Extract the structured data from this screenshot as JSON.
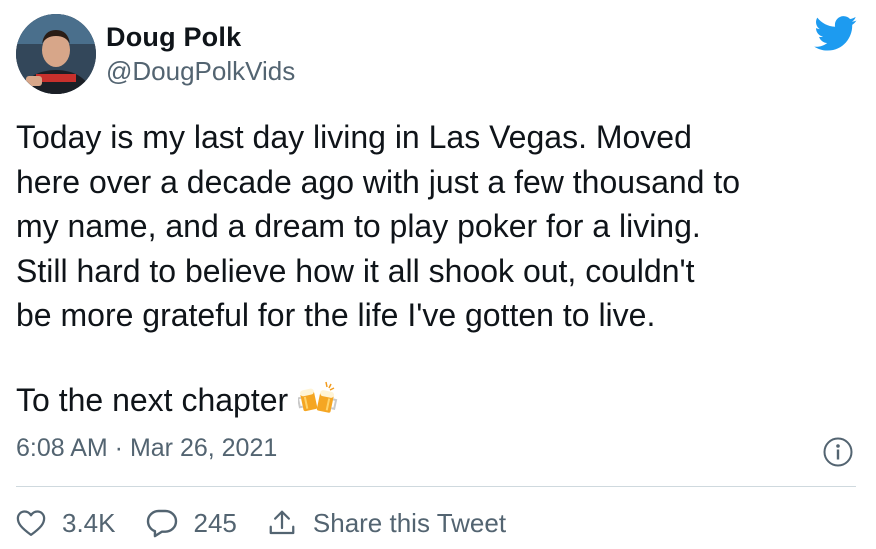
{
  "author": {
    "name": "Doug Polk",
    "handle": "@DougPolkVids"
  },
  "tweet": {
    "text": "Today is my last day living in Las Vegas. Moved\nhere over a decade ago with just a few thousand to\nmy name, and a dream to play poker for a living.\nStill hard to believe how it all shook out, couldn't\nbe more grateful for the life I've gotten to live.",
    "closing_text": "To the next chapter",
    "emoji": "clinking-beer-mugs",
    "timestamp": "6:08 AM · Mar 26, 2021"
  },
  "actions": {
    "like_count": "3.4K",
    "reply_count": "245",
    "share_label": "Share this Tweet"
  },
  "colors": {
    "text": "#0f1419",
    "secondary": "#536471",
    "twitter_blue": "#1d9bf0",
    "divider": "#cfd9de"
  },
  "icons": [
    "twitter-bird-icon",
    "info-icon",
    "heart-icon",
    "reply-bubble-icon",
    "share-icon",
    "beer-mugs-emoji"
  ]
}
